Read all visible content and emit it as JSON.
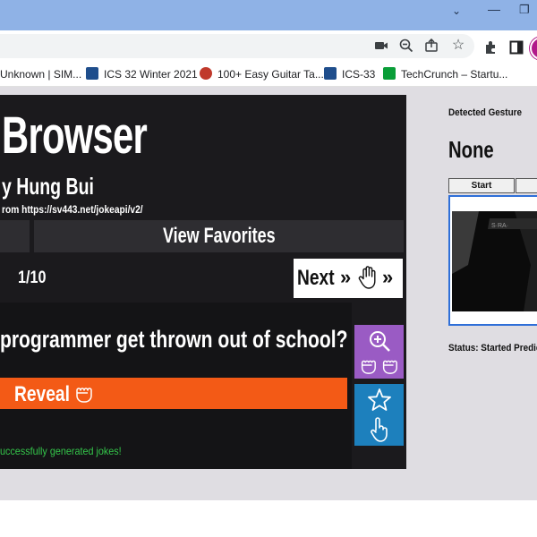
{
  "bookmarks": [
    {
      "label": "Unknown | SIM...",
      "color": "#ffffff"
    },
    {
      "label": "ICS 32 Winter 2021",
      "color": "#1f4e8c"
    },
    {
      "label": "100+ Easy Guitar Ta...",
      "color": "#c0392b"
    },
    {
      "label": "ICS-33",
      "color": "#1f4e8c"
    },
    {
      "label": "TechCrunch – Startu...",
      "color": "#0a9e38"
    }
  ],
  "app": {
    "title": "Browser",
    "author": "y Hung Bui",
    "source": "rom https://sv443.net/jokeapi/v2/",
    "favorites_label": "View Favorites",
    "counter": "1/10",
    "next_label": "Next",
    "joke": "programmer get thrown out of school?",
    "reveal_label": "Reveal",
    "status_message": "uccessfully generated jokes!",
    "accent_reveal": "#f35a16",
    "accent_zoom": "#9a5bc4",
    "accent_favorite": "#1d80bd"
  },
  "side_panel": {
    "gesture_label": "Detected Gesture",
    "gesture_value": "None",
    "start_label": "Start",
    "status": "Status: Started Predic"
  }
}
